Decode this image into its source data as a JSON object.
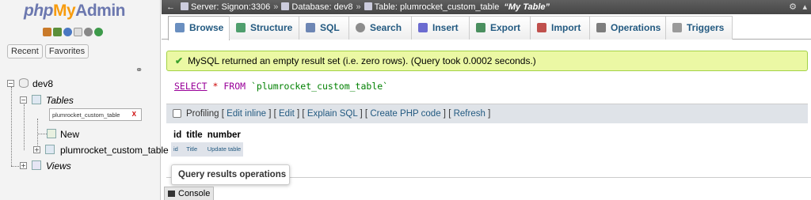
{
  "logo": {
    "php": "php",
    "my": "My",
    "admin": "Admin"
  },
  "nav_icons": [
    "home-icon",
    "exit-icon",
    "help-icon",
    "docs-icon",
    "settings-icon",
    "reload-icon"
  ],
  "nav_buttons": {
    "recent": "Recent",
    "favorites": "Favorites"
  },
  "tree": {
    "db": "dev8",
    "tables": "Tables",
    "filter_value": "plumrocket_custom_table",
    "filter_clear": "X",
    "new": "New",
    "table": "plumrocket_custom_table",
    "views": "Views"
  },
  "breadcrumb": {
    "server": "Server: Signon:3306",
    "database": "Database: dev8",
    "table": "Table: plumrocket_custom_table",
    "comment": "“My Table”",
    "sep": "»"
  },
  "tabs": [
    {
      "label": "Browse",
      "icon": "browse-icon",
      "color": "#6a8fc0"
    },
    {
      "label": "Structure",
      "icon": "structure-icon",
      "color": "#4f9e6d"
    },
    {
      "label": "SQL",
      "icon": "sql-icon",
      "color": "#6d86b4"
    },
    {
      "label": "Search",
      "icon": "search-icon",
      "color": "#8c8c8c"
    },
    {
      "label": "Insert",
      "icon": "insert-icon",
      "color": "#6b6bd0"
    },
    {
      "label": "Export",
      "icon": "export-icon",
      "color": "#4a8f5f"
    },
    {
      "label": "Import",
      "icon": "import-icon",
      "color": "#c0504d"
    },
    {
      "label": "Operations",
      "icon": "wrench-icon",
      "color": "#7d7d7d"
    },
    {
      "label": "Triggers",
      "icon": "triggers-icon",
      "color": "#9a9a9a"
    }
  ],
  "success_message": "MySQL returned an empty result set (i.e. zero rows). (Query took 0.0002 seconds.)",
  "sql": {
    "select": "SELECT",
    "star": "*",
    "from": "FROM",
    "table": "`plumrocket_custom_table`"
  },
  "profiling": {
    "label": "Profiling",
    "links": [
      "Edit inline",
      "Edit",
      "Explain SQL",
      "Create PHP code",
      "Refresh"
    ]
  },
  "results": {
    "headers": [
      "id",
      "title",
      "number"
    ],
    "row": [
      "id",
      "Title",
      "Update table"
    ]
  },
  "query_results_operations": "Query results operations",
  "console": "Console",
  "colors": {
    "accent": "#235a81",
    "success_bg": "#ebf8a4",
    "topbar": "#505050"
  }
}
